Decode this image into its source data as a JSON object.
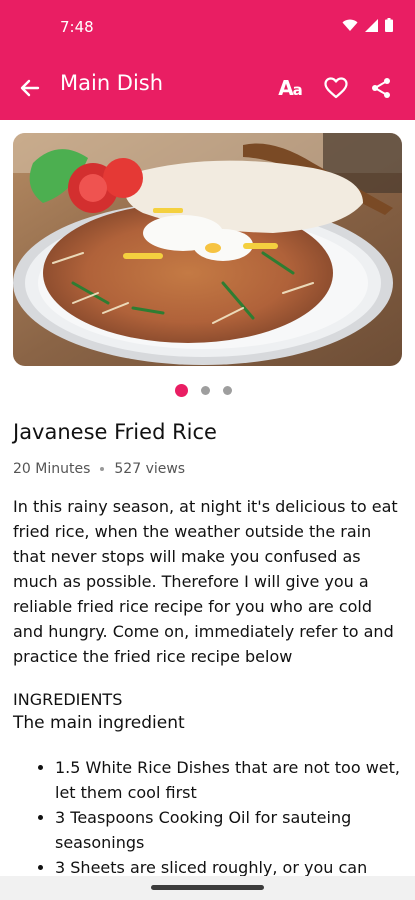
{
  "status": {
    "time": "7:48"
  },
  "appbar": {
    "title": "Main Dish",
    "text_size_label_big": "A",
    "text_size_label_small": "a"
  },
  "recipe": {
    "title": "Javanese Fried Rice",
    "duration": "20 Minutes",
    "views": "527 views",
    "description": "In this rainy season, at night it's delicious to eat fried rice, when the weather outside the rain that never stops will make you confused as much as possible. Therefore I will give you a reliable fried rice recipe for you who are cold and hungry. Come on, immediately refer to and practice the fried rice recipe below",
    "image_carousel": {
      "total": 3,
      "active": 1
    }
  },
  "ingredients": {
    "heading": "INGREDIENTS",
    "subheading": "The main ingredient",
    "items": [
      "1.5 White Rice Dishes that are not too wet, let them cool first",
      "3 Teaspoons Cooking Oil for sauteing seasonings",
      "3 Sheets are sliced roughly, or you can"
    ]
  },
  "colors": {
    "accent": "#e91e63"
  },
  "icons": [
    "back-arrow-icon",
    "text-size-icon",
    "heart-icon",
    "share-icon",
    "wifi-icon",
    "signal-icon",
    "battery-icon"
  ]
}
